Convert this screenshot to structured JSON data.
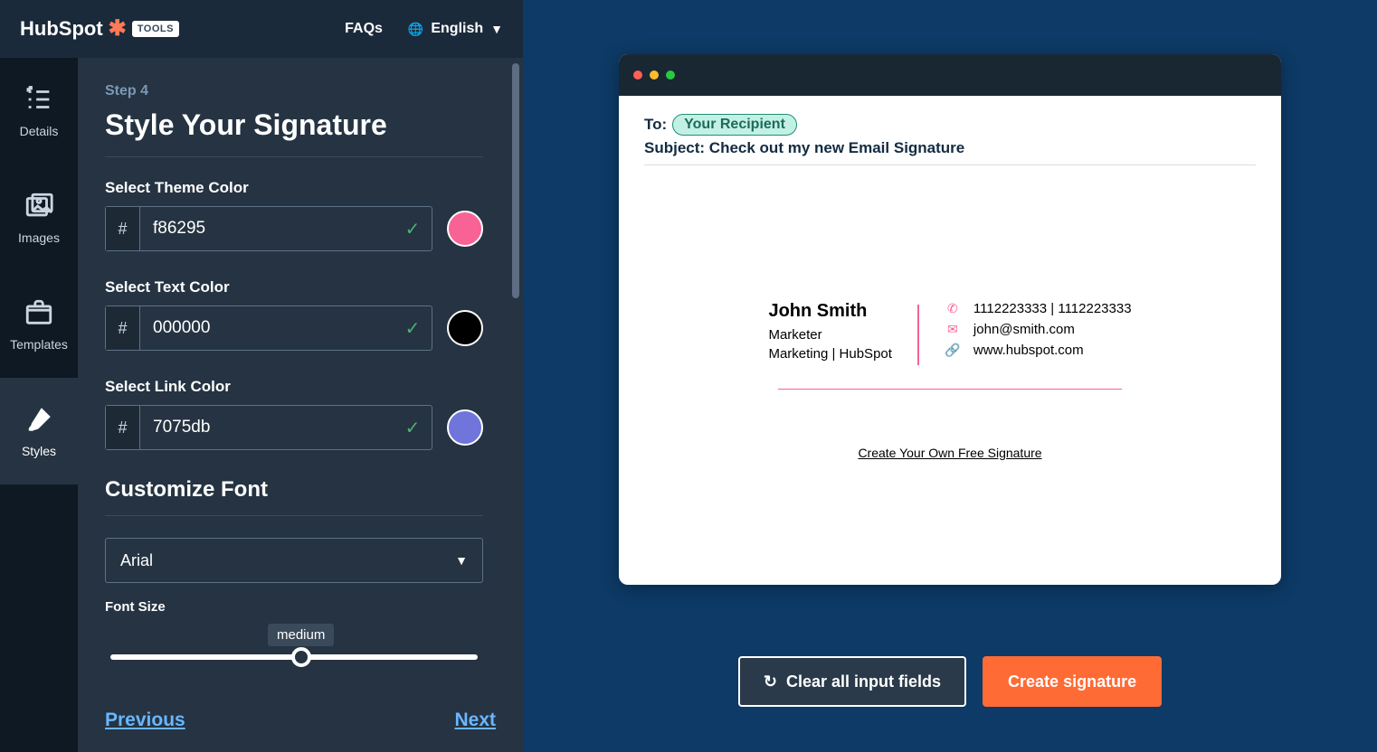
{
  "header": {
    "brand": "HubSpot",
    "tools_badge": "TOOLS",
    "faqs": "FAQs",
    "language": "English"
  },
  "sidebar": {
    "details": "Details",
    "images": "Images",
    "templates": "Templates",
    "styles": "Styles"
  },
  "editor": {
    "step_label": "Step 4",
    "title": "Style Your Signature",
    "theme_label": "Select Theme Color",
    "theme_value": "f86295",
    "theme_hex": "#f86295",
    "text_label": "Select Text Color",
    "text_value": "000000",
    "text_hex": "#000000",
    "link_label": "Select Link Color",
    "link_value": "7075db",
    "link_hex": "#7075db",
    "font_section": "Customize Font",
    "font_value": "Arial",
    "font_size_label": "Font Size",
    "font_size_value": "medium",
    "prev": "Previous",
    "next": "Next",
    "hash": "#"
  },
  "preview": {
    "to_label": "To:",
    "recipient": "Your Recipient",
    "subject_label": "Subject: ",
    "subject_value": "Check out my new Email Signature",
    "sig_name": "John Smith",
    "sig_role": "Marketer",
    "sig_dept": "Marketing | HubSpot",
    "sig_phone": "1112223333 | 1112223333",
    "sig_email": "john@smith.com",
    "sig_site": "www.hubspot.com",
    "free_link": "Create Your Own Free Signature"
  },
  "actions": {
    "clear": "Clear all input fields",
    "create": "Create signature"
  }
}
